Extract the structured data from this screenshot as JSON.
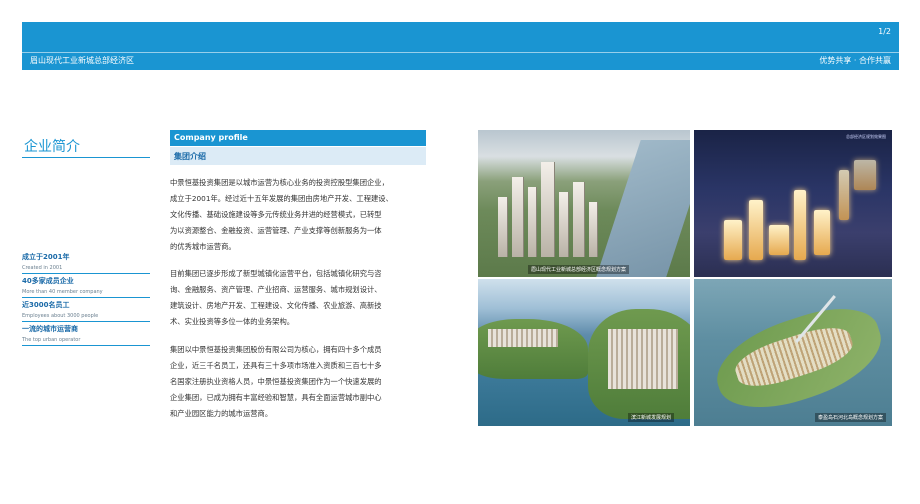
{
  "header": {
    "page_number": "1/2",
    "title": "眉山现代工业新城总部经济区",
    "slogan": "优势共享 · 合作共赢"
  },
  "section": {
    "title": "企业简介"
  },
  "facts": [
    {
      "cn": "成立于2001年",
      "en": "Created in 2001"
    },
    {
      "cn": "40多家成员企业",
      "en": "More than 40 member company"
    },
    {
      "cn": "近3000名员工",
      "en": "Employees about 3000 people"
    },
    {
      "cn": "一流的城市运营商",
      "en": "The top urban operator"
    }
  ],
  "profile": {
    "bar_label": "Company profile",
    "sub_label": "集团介绍",
    "paragraph1": [
      "中景恒基投资集团是以城市运营为核心业务的投资控股型集团企业，",
      "成立于2001年。经过近十五年发展的集团由房地产开发、工程建设、",
      "文化传播、基础设施建设等多元传统业务并进的经营模式，已转型",
      "为以资源整合、金融投资、运营管理、产业支撑等创新服务为一体",
      "的优秀城市运营商。"
    ],
    "paragraph2": [
      "目前集团已逐步形成了新型城镇化运营平台，包括城镇化研究与咨",
      "询、金融服务、资产管理、产业招商、运营服务、城市规划设计、",
      "建筑设计、房地产开发、工程建设、文化传播、农业旅游、高新技",
      "术、实业投资等多位一体的业务架构。"
    ],
    "paragraph3": [
      "集团以中景恒基投资集团股份有限公司为核心，拥有四十多个成员",
      "企业，近三千名员工，还具有三十多项市场准入资质和三百七十多",
      "名国家注册执业资格人员，中景恒基投资集团作为一个快速发展的",
      "企业集团，已成为拥有丰富经验和智慧，具有全面运营城市副中心",
      "和产业园区能力的城市运营商。"
    ]
  },
  "photos": {
    "p1_caption": "眉山现代工业新城总部经济区概念规划方案",
    "p2_caption": "总部经济区规划效果图",
    "p3_caption": "滨江新城发展规划",
    "p4_caption": "泰盈岛石河北岛概念规划方案"
  },
  "colors": {
    "accent": "#1a95d2",
    "accent_light": "#dcebf6",
    "fact_text": "#1a6aa8"
  }
}
